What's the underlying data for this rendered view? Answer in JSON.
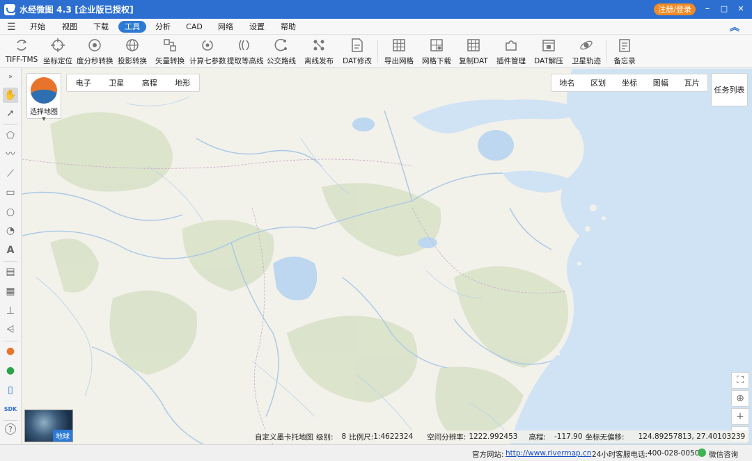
{
  "window": {
    "title": "水经微图 4.3 [企业版已授权]",
    "login_label": "注册/登录",
    "minimize": "–",
    "maximize": "□",
    "close": "✕"
  },
  "menu": {
    "items": [
      {
        "label": "开始",
        "active": false
      },
      {
        "label": "视图",
        "active": false
      },
      {
        "label": "下载",
        "active": false
      },
      {
        "label": "工具",
        "active": true
      },
      {
        "label": "分析",
        "active": false
      },
      {
        "label": "CAD",
        "active": false
      },
      {
        "label": "网络",
        "active": false
      },
      {
        "label": "设置",
        "active": false
      },
      {
        "label": "帮助",
        "active": false
      }
    ]
  },
  "toolbar": {
    "tools": [
      {
        "label": "TIFF-TMS",
        "icon": "refresh-icon"
      },
      {
        "label": "坐标定位",
        "icon": "crosshair-icon"
      },
      {
        "label": "度分秒转换",
        "icon": "target-icon"
      },
      {
        "label": "投影转换",
        "icon": "globe-icon"
      },
      {
        "label": "矢量转换",
        "icon": "vector-icon"
      },
      {
        "label": "计算七参数",
        "icon": "cycle-icon"
      },
      {
        "label": "提取等高线",
        "icon": "contour-icon"
      },
      {
        "label": "公交路线",
        "icon": "route-icon"
      },
      {
        "label": "离线发布",
        "icon": "publish-icon"
      },
      {
        "label": "DAT修改",
        "icon": "dat-file-icon"
      },
      {
        "label": "导出网格",
        "icon": "grid-export-icon"
      },
      {
        "label": "网格下载",
        "icon": "grid-download-icon"
      },
      {
        "label": "复制DAT",
        "icon": "copy-dat-icon"
      },
      {
        "label": "插件管理",
        "icon": "plugin-icon"
      },
      {
        "label": "DAT解压",
        "icon": "unzip-icon"
      },
      {
        "label": "卫星轨迹",
        "icon": "satellite-icon"
      },
      {
        "label": "备忘录",
        "icon": "notes-icon"
      }
    ]
  },
  "sidebar": {
    "tools": [
      "collapse-icon",
      "pan-hand-icon",
      "select-arrow-icon",
      "polygon-icon",
      "polyline-icon",
      "line-chart-icon",
      "rectangle-icon",
      "circle-icon",
      "sector-icon",
      "text-icon",
      "ruler-icon",
      "area-measure-icon",
      "elevation-icon",
      "profile-icon",
      "layer-logo-icon",
      "link-icon",
      "phone-icon",
      "sdk-icon",
      "help-icon"
    ],
    "sdk_label": "SDK",
    "text_label": "A",
    "help_label": "?"
  },
  "map": {
    "chooser_label": "选择地图",
    "basemap_tabs": [
      "电子",
      "卫星",
      "高程",
      "地形"
    ],
    "overlay_tabs": [
      "地名",
      "区划",
      "坐标",
      "图幅",
      "瓦片"
    ],
    "task_list_label": "任务列表",
    "globe_label": "地球",
    "colors": {
      "land": "#f2f1ea",
      "water": "#bcd7ef",
      "sea": "#cfe3f5",
      "hill": "#d9e2c9"
    },
    "info": {
      "map_name": "自定义墨卡托地图",
      "level_label": "级别:",
      "level_value": "8",
      "scale_label": "比例尺:",
      "scale_value": "1:4622324",
      "resolution_label": "空间分辨率:",
      "resolution_value": "1222.992453",
      "elevation_label": "高程:",
      "elevation_value": "-117.90",
      "coord_label": "坐标无偏移:",
      "coord_value": "124.89257813, 27.40103239"
    }
  },
  "status": {
    "website_label": "官方网站:",
    "website_url": "http://www.rivermap.cn",
    "phone_label": "24小时客服电话:",
    "phone_value": "400-028-0050",
    "wechat_label": "微信咨询"
  }
}
